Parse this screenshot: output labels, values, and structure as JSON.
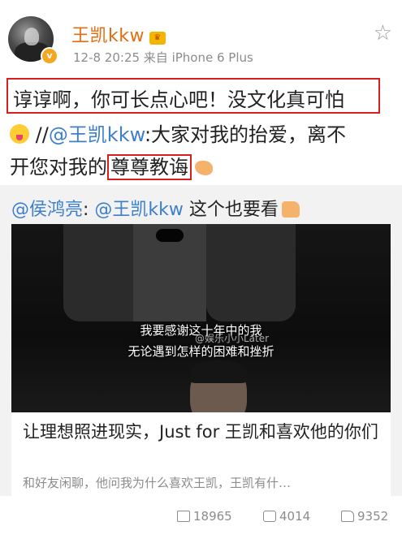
{
  "post": {
    "username": "王凯kkw",
    "meta": "12-8 20:25  来自 iPhone 6 Plus",
    "line1": "谆谆啊，你可长点心吧！没文化真可怕",
    "line2_prefix": " //",
    "line2_mention": "@王凯kkw",
    "line2_rest": ":大家对我的抬爱，离不",
    "line3_pre": "开您对我的",
    "line3_boxed": "尊尊教诲"
  },
  "repost": {
    "mention_user": "@侯鸿亮",
    "colon": ": ",
    "mention_target": "@王凯kkw",
    "text": " 这个也要看",
    "video": {
      "subtitle1": "我要感谢这十年中的我",
      "subtitle2": "无论遇到怎样的困难和挫折",
      "watermark": "@娱乐小小Later"
    },
    "card": {
      "title": "让理想照进现实，Just for 王凯和喜欢他的你们",
      "desc": "和好友闲聊，他问我为什么喜欢王凯，王凯有什…"
    }
  },
  "actions": {
    "reposts": "18965",
    "comments": "4014",
    "likes": "9352"
  },
  "colors": {
    "username": "#e86b0f",
    "mention": "#3b7fcd",
    "highlight_box": "#d81e1e"
  },
  "icons": [
    "star-icon",
    "crown-icon",
    "verified-icon",
    "emoji-face-icon",
    "flexed-arm-icon",
    "thumbs-up-icon",
    "share-icon",
    "comment-icon",
    "like-icon"
  ]
}
